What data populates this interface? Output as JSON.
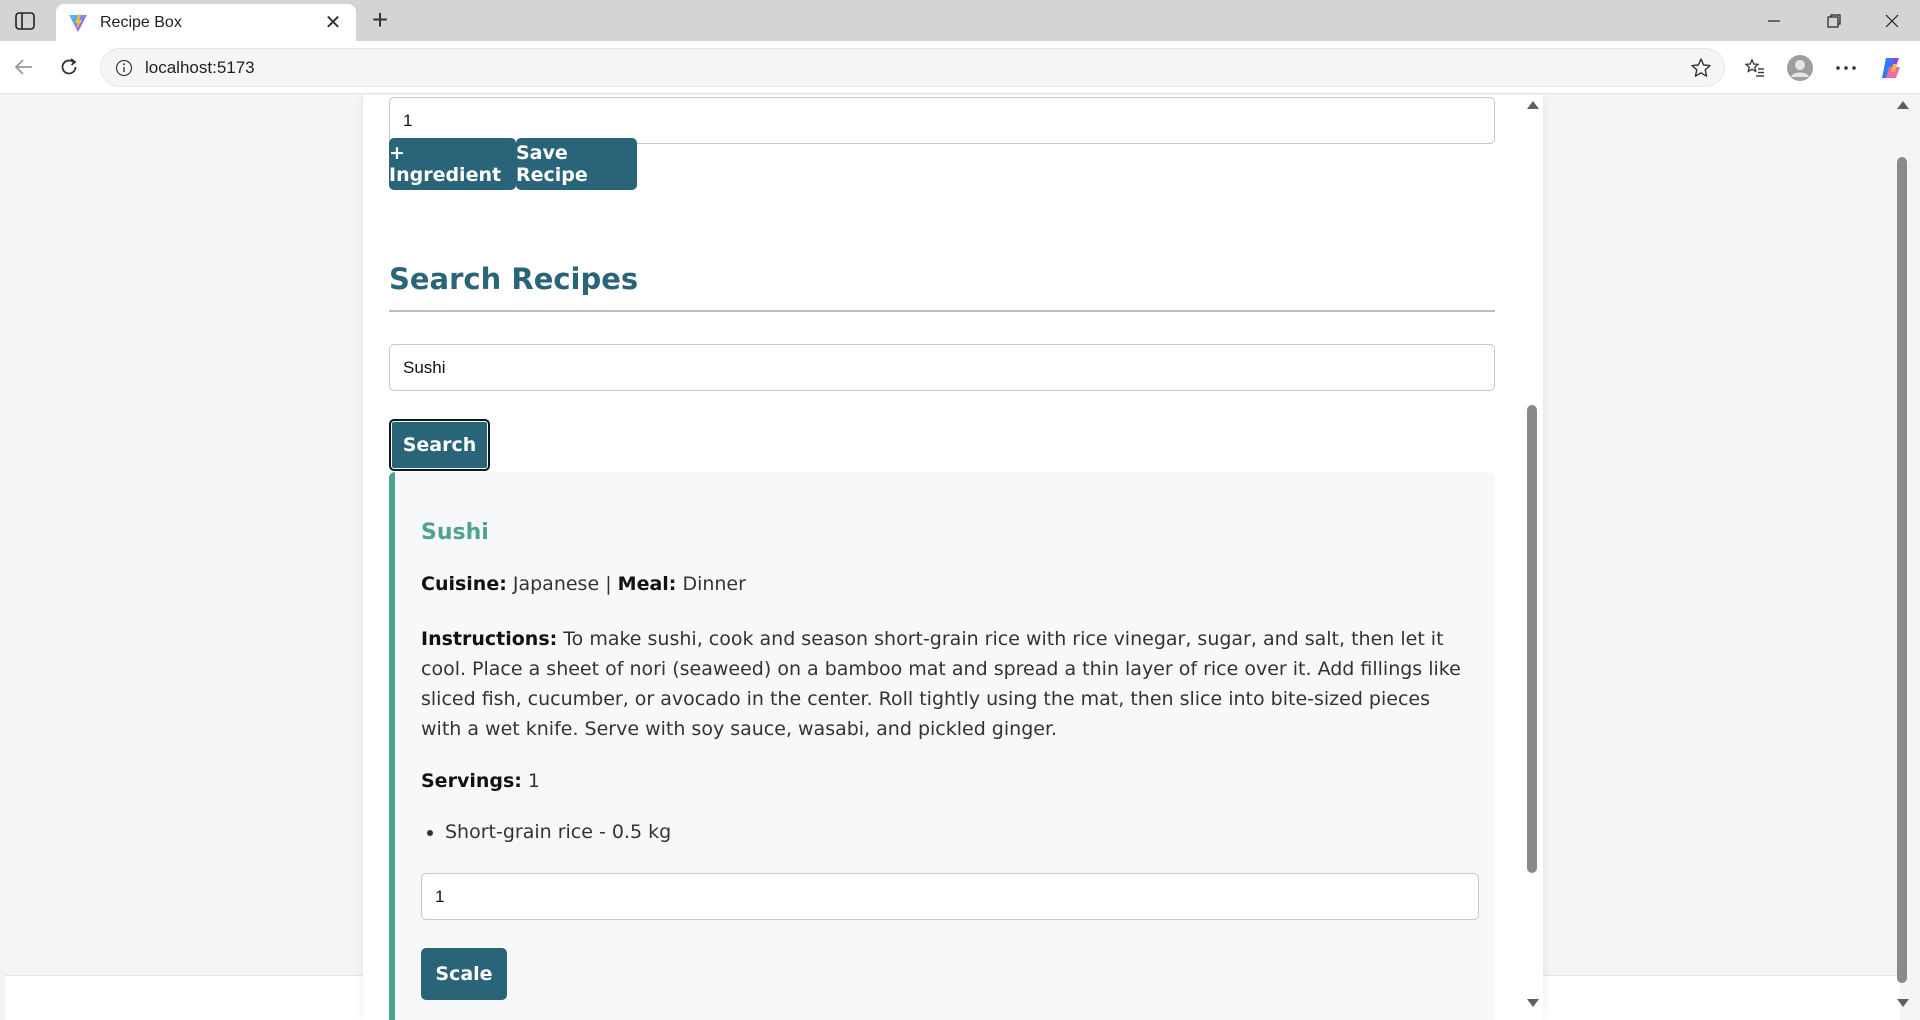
{
  "browser": {
    "tab_title": "Recipe Box",
    "url": "localhost:5173"
  },
  "form": {
    "top_input_value": "1",
    "add_ingredient_label": "+ Ingredient",
    "save_recipe_label": "Save Recipe"
  },
  "search": {
    "heading": "Search Recipes",
    "input_value": "Sushi",
    "button_label": "Search"
  },
  "result": {
    "name": "Sushi",
    "cuisine_label": "Cuisine:",
    "cuisine": "Japanese",
    "separator": "|",
    "meal_label": "Meal:",
    "meal": "Dinner",
    "instructions_label": "Instructions:",
    "instructions": "To make sushi, cook and season short-grain rice with rice vinegar, sugar, and salt, then let it cool. Place a sheet of nori (seaweed) on a bamboo mat and spread a thin layer of rice over it. Add fillings like sliced fish, cucumber, or avocado in the center. Roll tightly using the mat, then slice into bite-sized pieces with a wet knife. Serve with soy sauce, wasabi, and pickled ginger.",
    "servings_label": "Servings:",
    "servings": "1",
    "ingredients": [
      "Short-grain rice - 0.5 kg"
    ],
    "scale_input_value": "1",
    "scale_label": "Scale"
  },
  "colors": {
    "primary": "#2a6478",
    "accent": "#4fa38e"
  }
}
